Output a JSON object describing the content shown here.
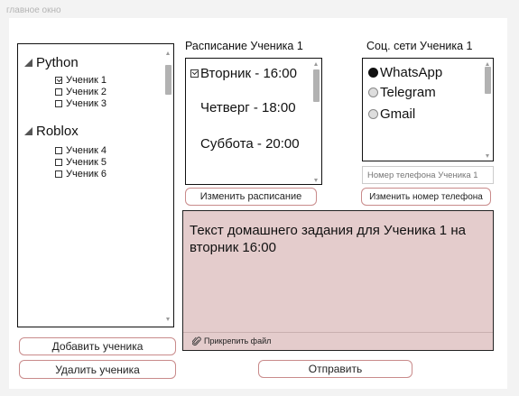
{
  "window": {
    "title": "главное окно"
  },
  "students_tree": {
    "groups": [
      {
        "name": "Python",
        "students": [
          {
            "label": "Ученик 1",
            "checked": true
          },
          {
            "label": "Ученик 2",
            "checked": false
          },
          {
            "label": "Ученик 3",
            "checked": false
          }
        ]
      },
      {
        "name": "Roblox",
        "students": [
          {
            "label": "Ученик 4",
            "checked": false
          },
          {
            "label": "Ученик 5",
            "checked": false
          },
          {
            "label": "Ученик 6",
            "checked": false
          }
        ]
      }
    ]
  },
  "actions": {
    "add_student": "Добавить ученика",
    "remove_student": "Удалить ученика",
    "send": "Отправить"
  },
  "schedule": {
    "title": "Расписание Ученика 1",
    "items": [
      {
        "label": "Вторник - 16:00",
        "checked": true
      },
      {
        "label": "Четверг - 18:00",
        "checked": false
      },
      {
        "label": "Суббота - 20:00",
        "checked": false
      }
    ],
    "edit_button": "Изменить расписание"
  },
  "social": {
    "title": "Соц. сети Ученика 1",
    "options": [
      {
        "label": "WhatsApp",
        "selected": true
      },
      {
        "label": "Telegram",
        "selected": false
      },
      {
        "label": "Gmail",
        "selected": false
      }
    ],
    "phone_placeholder": "Номер телефона Ученика 1",
    "change_phone_button": "Изменить номер телефона"
  },
  "homework": {
    "text": "Текст домашнего задания для Ученика 1 на вторник 16:00",
    "attach_label": "Прикрепить файл",
    "background_color": "#e4cccc"
  },
  "colors": {
    "button_border": "#c98b8b"
  }
}
